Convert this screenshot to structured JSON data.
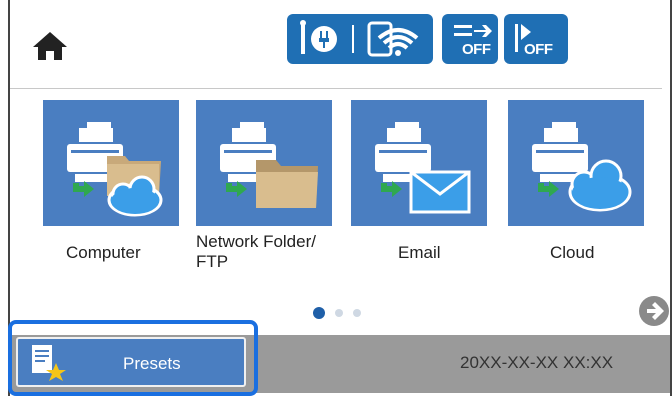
{
  "header": {
    "home_icon": "home-icon",
    "status_icons": [
      "ethernet-icon",
      "wifi-icon",
      "sound-off-icon",
      "print-off-icon"
    ],
    "status_labels": {
      "sound": "OFF",
      "print": "OFF"
    }
  },
  "functions": [
    {
      "label": "Computer",
      "icon": "scan-to-computer-icon"
    },
    {
      "label_line1": "Network Folder/",
      "label_line2": "FTP",
      "icon": "scan-to-network-folder-icon"
    },
    {
      "label": "Email",
      "icon": "scan-to-email-icon"
    },
    {
      "label": "Cloud",
      "icon": "scan-to-cloud-icon"
    }
  ],
  "pagination": {
    "current_page": 1,
    "total_pages": 3
  },
  "footer": {
    "presets_label": "Presets",
    "datetime": "20XX-XX-XX XX:XX"
  },
  "colors": {
    "tile_blue": "#4a7ec1",
    "status_blue": "#1f6fb4",
    "focus_blue": "#1a6fe0",
    "bottom_bar": "#9a9a9a"
  }
}
